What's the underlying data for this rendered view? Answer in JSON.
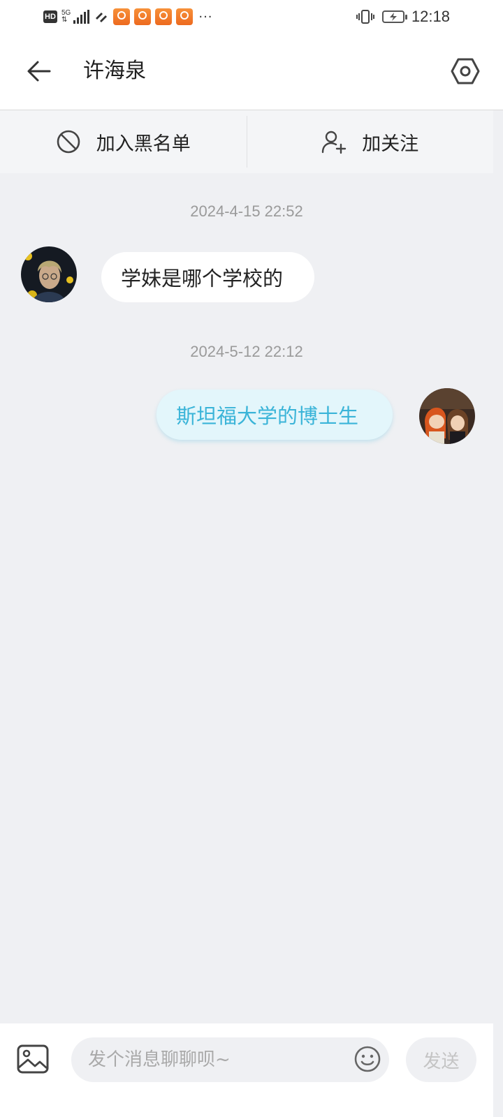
{
  "status_bar": {
    "network_hd": "HD",
    "network_type": "5G",
    "time": "12:18",
    "icons": [
      "hd-icon",
      "signal-icon",
      "wifi-icon",
      "app-notification-icon",
      "app-notification-icon",
      "app-notification-icon",
      "app-notification-icon",
      "more-notifications-icon",
      "vibrate-icon",
      "battery-charging-icon"
    ]
  },
  "header": {
    "title": "许海泉",
    "back_icon": "arrow-left-icon",
    "settings_icon": "hexagon-settings-icon"
  },
  "actions": {
    "blacklist_label": "加入黑名单",
    "blacklist_icon": "block-icon",
    "follow_label": "加关注",
    "follow_icon": "add-user-icon"
  },
  "messages": [
    {
      "timestamp": "2024-4-15 22:52",
      "sender": "other",
      "text": "学妹是哪个学校的"
    },
    {
      "timestamp": "2024-5-12 22:12",
      "sender": "self",
      "text": "斯坦福大学的博士生"
    }
  ],
  "composer": {
    "image_icon": "image-icon",
    "placeholder": "发个消息聊聊呗~",
    "value": "",
    "emoji_icon": "emoji-icon",
    "send_label": "发送"
  },
  "colors": {
    "background": "#eff0f3",
    "outgoing_bubble": "#e3f6fb",
    "outgoing_text": "#3ab4d8",
    "incoming_bubble": "#ffffff"
  }
}
